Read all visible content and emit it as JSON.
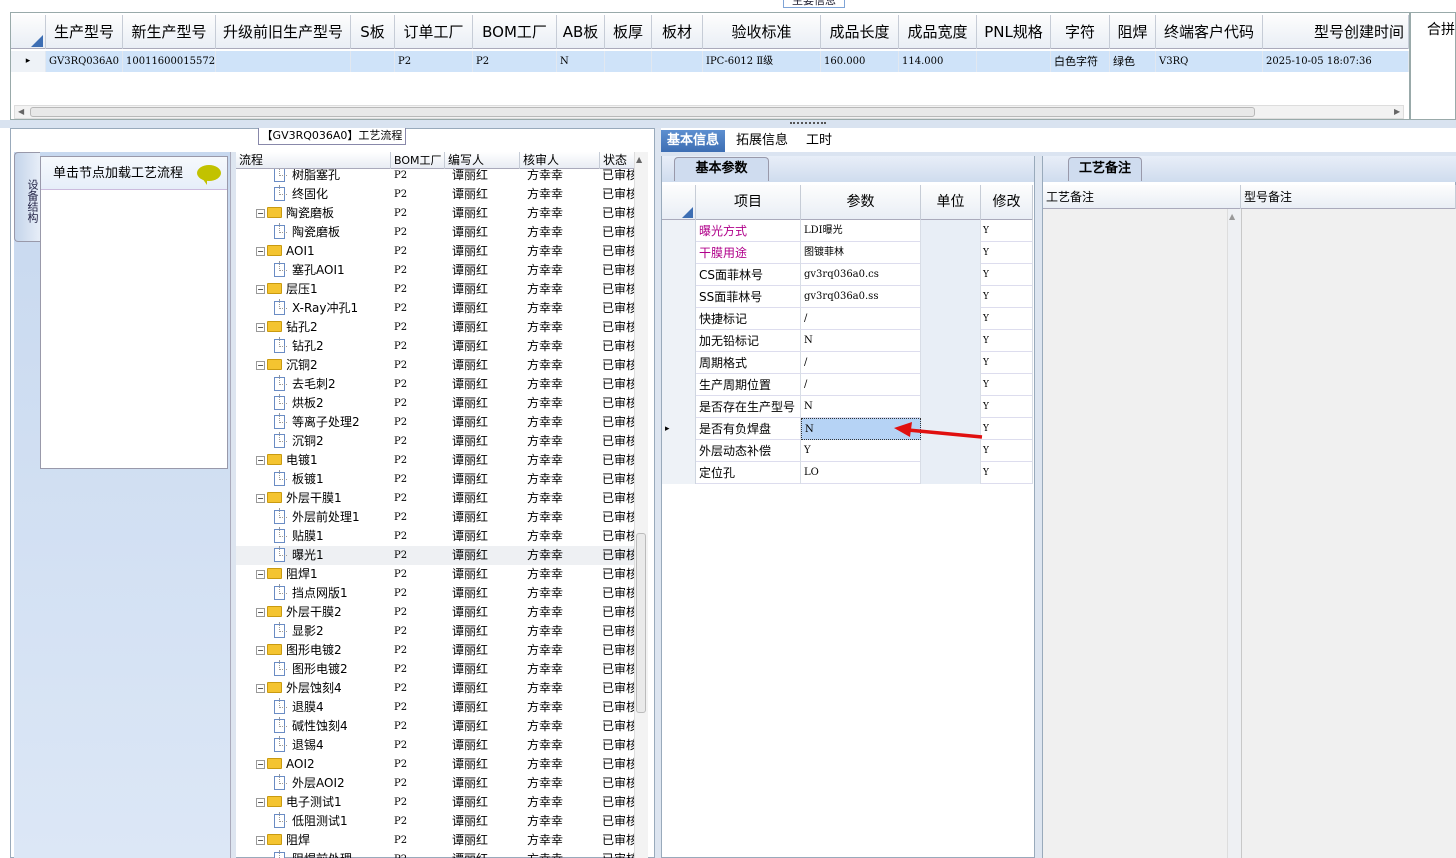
{
  "top_panel": {
    "title": "主要信息",
    "headers": [
      "生产型号",
      "新生产型号",
      "升级前旧生产型号",
      "S板",
      "订单工厂",
      "BOM工厂",
      "AB板",
      "板厚",
      "板材",
      "验收标准",
      "成品长度",
      "成品宽度",
      "PNL规格",
      "字符",
      "阻焊",
      "终端客户代码",
      "型号创建时间"
    ],
    "row": {
      "marker": "▸",
      "model": "GV3RQ036A0",
      "new_model": "10011600015572",
      "old_model": "",
      "s_board": "",
      "order_factory": "P2",
      "bom_factory": "P2",
      "ab_board": "N",
      "thickness": "",
      "material": "",
      "standard": "IPC-6012 Ⅱ级",
      "length": "160.000",
      "width": "114.000",
      "pnl": "",
      "char": "白色字符",
      "solder": "绿色",
      "customer": "V3RQ",
      "created": "2025-10-05 18:07:36"
    },
    "merge_label": "合拼"
  },
  "left_panel": {
    "title": "【GV3RQ036A0】工艺流程",
    "side_tab": "设备结构",
    "side_header": "单击节点加载工艺流程",
    "tree_headers": [
      "流程",
      "BOM工厂",
      "编写人",
      "核审人",
      "状态"
    ],
    "tree_rows": [
      {
        "indent": 2,
        "icon": "doc",
        "name": "树脂塞孔",
        "bom": "P2",
        "writer": "谭丽红",
        "reviewer": "方幸幸",
        "status": "已审核"
      },
      {
        "indent": 2,
        "icon": "doc",
        "name": "终固化",
        "bom": "P2",
        "writer": "谭丽红",
        "reviewer": "方幸幸",
        "status": "已审核"
      },
      {
        "indent": 1,
        "icon": "folder",
        "name": "陶瓷磨板",
        "bom": "P2",
        "writer": "谭丽红",
        "reviewer": "方幸幸",
        "status": "已审核"
      },
      {
        "indent": 2,
        "icon": "doc",
        "name": "陶瓷磨板",
        "bom": "P2",
        "writer": "谭丽红",
        "reviewer": "方幸幸",
        "status": "已审核"
      },
      {
        "indent": 1,
        "icon": "folder",
        "name": "AOI1",
        "bom": "P2",
        "writer": "谭丽红",
        "reviewer": "方幸幸",
        "status": "已审核"
      },
      {
        "indent": 2,
        "icon": "doc",
        "name": "塞孔AOI1",
        "bom": "P2",
        "writer": "谭丽红",
        "reviewer": "方幸幸",
        "status": "已审核"
      },
      {
        "indent": 1,
        "icon": "folder",
        "name": "层压1",
        "bom": "P2",
        "writer": "谭丽红",
        "reviewer": "方幸幸",
        "status": "已审核"
      },
      {
        "indent": 2,
        "icon": "doc",
        "name": "X-Ray冲孔1",
        "bom": "P2",
        "writer": "谭丽红",
        "reviewer": "方幸幸",
        "status": "已审核"
      },
      {
        "indent": 1,
        "icon": "folder",
        "name": "钻孔2",
        "bom": "P2",
        "writer": "谭丽红",
        "reviewer": "方幸幸",
        "status": "已审核"
      },
      {
        "indent": 2,
        "icon": "doc",
        "name": "钻孔2",
        "bom": "P2",
        "writer": "谭丽红",
        "reviewer": "方幸幸",
        "status": "已审核"
      },
      {
        "indent": 1,
        "icon": "folder",
        "name": "沉铜2",
        "bom": "P2",
        "writer": "谭丽红",
        "reviewer": "方幸幸",
        "status": "已审核"
      },
      {
        "indent": 2,
        "icon": "doc",
        "name": "去毛刺2",
        "bom": "P2",
        "writer": "谭丽红",
        "reviewer": "方幸幸",
        "status": "已审核"
      },
      {
        "indent": 2,
        "icon": "doc",
        "name": "烘板2",
        "bom": "P2",
        "writer": "谭丽红",
        "reviewer": "方幸幸",
        "status": "已审核"
      },
      {
        "indent": 2,
        "icon": "doc",
        "name": "等离子处理2",
        "bom": "P2",
        "writer": "谭丽红",
        "reviewer": "方幸幸",
        "status": "已审核"
      },
      {
        "indent": 2,
        "icon": "doc",
        "name": "沉铜2",
        "bom": "P2",
        "writer": "谭丽红",
        "reviewer": "方幸幸",
        "status": "已审核"
      },
      {
        "indent": 1,
        "icon": "folder",
        "name": "电镀1",
        "bom": "P2",
        "writer": "谭丽红",
        "reviewer": "方幸幸",
        "status": "已审核"
      },
      {
        "indent": 2,
        "icon": "doc",
        "name": "板镀1",
        "bom": "P2",
        "writer": "谭丽红",
        "reviewer": "方幸幸",
        "status": "已审核"
      },
      {
        "indent": 1,
        "icon": "folder",
        "name": "外层干膜1",
        "bom": "P2",
        "writer": "谭丽红",
        "reviewer": "方幸幸",
        "status": "已审核"
      },
      {
        "indent": 2,
        "icon": "doc",
        "name": "外层前处理1",
        "bom": "P2",
        "writer": "谭丽红",
        "reviewer": "方幸幸",
        "status": "已审核"
      },
      {
        "indent": 2,
        "icon": "doc",
        "name": "贴膜1",
        "bom": "P2",
        "writer": "谭丽红",
        "reviewer": "方幸幸",
        "status": "已审核"
      },
      {
        "indent": 2,
        "icon": "doc",
        "name": "曝光1",
        "bom": "P2",
        "writer": "谭丽红",
        "reviewer": "方幸幸",
        "status": "已审核",
        "selected": true
      },
      {
        "indent": 1,
        "icon": "folder",
        "name": "阻焊1",
        "bom": "P2",
        "writer": "谭丽红",
        "reviewer": "方幸幸",
        "status": "已审核"
      },
      {
        "indent": 2,
        "icon": "doc",
        "name": "挡点网版1",
        "bom": "P2",
        "writer": "谭丽红",
        "reviewer": "方幸幸",
        "status": "已审核"
      },
      {
        "indent": 1,
        "icon": "folder",
        "name": "外层干膜2",
        "bom": "P2",
        "writer": "谭丽红",
        "reviewer": "方幸幸",
        "status": "已审核"
      },
      {
        "indent": 2,
        "icon": "doc",
        "name": "显影2",
        "bom": "P2",
        "writer": "谭丽红",
        "reviewer": "方幸幸",
        "status": "已审核"
      },
      {
        "indent": 1,
        "icon": "folder",
        "name": "图形电镀2",
        "bom": "P2",
        "writer": "谭丽红",
        "reviewer": "方幸幸",
        "status": "已审核"
      },
      {
        "indent": 2,
        "icon": "doc",
        "name": "图形电镀2",
        "bom": "P2",
        "writer": "谭丽红",
        "reviewer": "方幸幸",
        "status": "已审核"
      },
      {
        "indent": 1,
        "icon": "folder",
        "name": "外层蚀刻4",
        "bom": "P2",
        "writer": "谭丽红",
        "reviewer": "方幸幸",
        "status": "已审核"
      },
      {
        "indent": 2,
        "icon": "doc",
        "name": "退膜4",
        "bom": "P2",
        "writer": "谭丽红",
        "reviewer": "方幸幸",
        "status": "已审核"
      },
      {
        "indent": 2,
        "icon": "doc",
        "name": "碱性蚀刻4",
        "bom": "P2",
        "writer": "谭丽红",
        "reviewer": "方幸幸",
        "status": "已审核"
      },
      {
        "indent": 2,
        "icon": "doc",
        "name": "退锡4",
        "bom": "P2",
        "writer": "谭丽红",
        "reviewer": "方幸幸",
        "status": "已审核"
      },
      {
        "indent": 1,
        "icon": "folder",
        "name": "AOI2",
        "bom": "P2",
        "writer": "谭丽红",
        "reviewer": "方幸幸",
        "status": "已审核"
      },
      {
        "indent": 2,
        "icon": "doc",
        "name": "外层AOI2",
        "bom": "P2",
        "writer": "谭丽红",
        "reviewer": "方幸幸",
        "status": "已审核"
      },
      {
        "indent": 1,
        "icon": "folder",
        "name": "电子测试1",
        "bom": "P2",
        "writer": "谭丽红",
        "reviewer": "方幸幸",
        "status": "已审核"
      },
      {
        "indent": 2,
        "icon": "doc",
        "name": "低阻测试1",
        "bom": "P2",
        "writer": "谭丽红",
        "reviewer": "方幸幸",
        "status": "已审核"
      },
      {
        "indent": 1,
        "icon": "folder",
        "name": "阻焊",
        "bom": "P2",
        "writer": "谭丽红",
        "reviewer": "方幸幸",
        "status": "已审核"
      },
      {
        "indent": 2,
        "icon": "doc",
        "name": "阻焊前处理",
        "bom": "P2",
        "writer": "谭丽红",
        "reviewer": "方幸幸",
        "status": "已审核"
      }
    ]
  },
  "right_panel": {
    "tabs": [
      "基本信息",
      "拓展信息",
      "工时"
    ],
    "basic_title": "基本参数",
    "param_headers": [
      "项目",
      "参数",
      "单位",
      "修改"
    ],
    "params": [
      {
        "item": "曝光方式",
        "value": "LDI曝光",
        "unit": "",
        "edit": "Y",
        "highlight": true
      },
      {
        "item": "干膜用途",
        "value": "图镀菲林",
        "unit": "",
        "edit": "Y",
        "highlight": true
      },
      {
        "item": "CS面菲林号",
        "value": "gv3rq036a0.cs",
        "unit": "",
        "edit": "Y"
      },
      {
        "item": "SS面菲林号",
        "value": "gv3rq036a0.ss",
        "unit": "",
        "edit": "Y"
      },
      {
        "item": "快捷标记",
        "value": "/",
        "unit": "",
        "edit": "Y"
      },
      {
        "item": "加无铅标记",
        "value": "N",
        "unit": "",
        "edit": "Y"
      },
      {
        "item": "周期格式",
        "value": "/",
        "unit": "",
        "edit": "Y"
      },
      {
        "item": "生产周期位置",
        "value": "/",
        "unit": "",
        "edit": "Y"
      },
      {
        "item": "是否存在生产型号",
        "value": "N",
        "unit": "",
        "edit": "Y"
      },
      {
        "item": "是否有负焊盘",
        "value": "N",
        "unit": "",
        "edit": "Y",
        "current": true
      },
      {
        "item": "外层动态补偿",
        "value": "Y",
        "unit": "",
        "edit": "Y"
      },
      {
        "item": "定位孔",
        "value": "LO",
        "unit": "",
        "edit": "Y"
      }
    ],
    "remark_title": "工艺备注",
    "remark_headers": [
      "工艺备注",
      "型号备注"
    ],
    "colors": {
      "accent": "#3d6eb3",
      "highlight_text": "#b0008a",
      "selection": "#cfe3f9",
      "arrow": "#e01010"
    }
  }
}
